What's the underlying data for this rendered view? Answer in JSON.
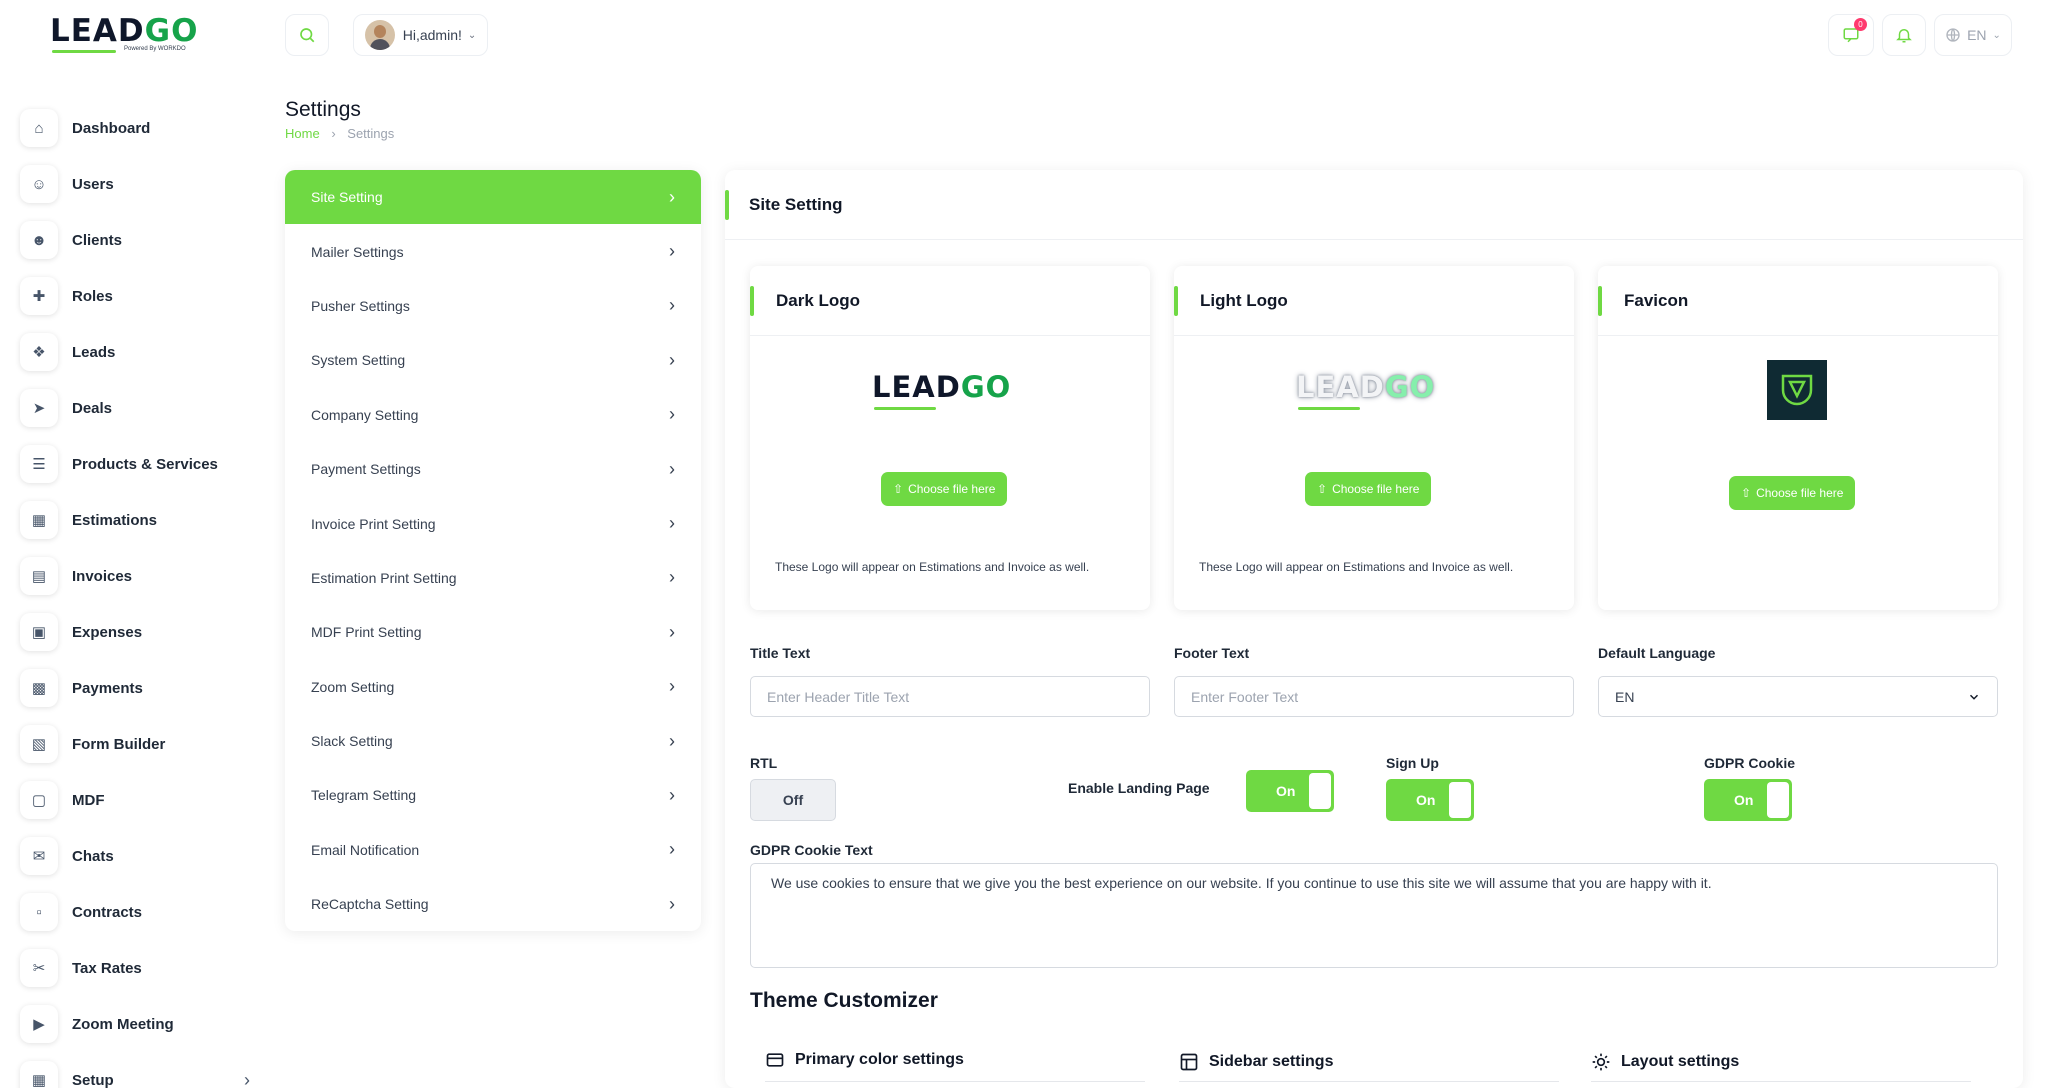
{
  "brand": {
    "logo_main": "LEAD",
    "logo_accent": "GO",
    "logo_sub": "Powered By WORKDO"
  },
  "topbar": {
    "user_greeting": "Hi,admin!",
    "notification_count": "0",
    "language": "EN"
  },
  "sidebar": {
    "items": [
      {
        "label": "Dashboard",
        "icon": "home-icon"
      },
      {
        "label": "Users",
        "icon": "users-icon"
      },
      {
        "label": "Clients",
        "icon": "user-icon"
      },
      {
        "label": "Roles",
        "icon": "user-plus-icon"
      },
      {
        "label": "Leads",
        "icon": "leads-icon"
      },
      {
        "label": "Deals",
        "icon": "rocket-icon"
      },
      {
        "label": "Products & Services",
        "icon": "products-icon"
      },
      {
        "label": "Estimations",
        "icon": "estimations-icon"
      },
      {
        "label": "Invoices",
        "icon": "file-icon"
      },
      {
        "label": "Expenses",
        "icon": "expenses-icon"
      },
      {
        "label": "Payments",
        "icon": "payments-icon"
      },
      {
        "label": "Form Builder",
        "icon": "form-icon"
      },
      {
        "label": "MDF",
        "icon": "mdf-icon"
      },
      {
        "label": "Chats",
        "icon": "chat-icon"
      },
      {
        "label": "Contracts",
        "icon": "contract-icon"
      },
      {
        "label": "Tax Rates",
        "icon": "scissors-icon"
      },
      {
        "label": "Zoom Meeting",
        "icon": "video-icon"
      },
      {
        "label": "Setup",
        "icon": "grid-icon"
      }
    ]
  },
  "page": {
    "title": "Settings",
    "breadcrumb_home": "Home",
    "breadcrumb_current": "Settings"
  },
  "settings_menu": [
    "Site Setting",
    "Mailer Settings",
    "Pusher Settings",
    "System Setting",
    "Company Setting",
    "Payment Settings",
    "Invoice Print Setting",
    "Estimation Print Setting",
    "MDF Print Setting",
    "Zoom Setting",
    "Slack Setting",
    "Telegram Setting",
    "Email Notification",
    "ReCaptcha Setting"
  ],
  "site_setting": {
    "title": "Site Setting",
    "dark_logo": {
      "title": "Dark Logo",
      "button": "Choose file here",
      "note": "These Logo will appear on Estimations and Invoice as well."
    },
    "light_logo": {
      "title": "Light Logo",
      "button": "Choose file here",
      "note": "These Logo will appear on Estimations and Invoice as well."
    },
    "favicon": {
      "title": "Favicon",
      "button": "Choose file here"
    },
    "title_text": {
      "label": "Title Text",
      "placeholder": "Enter Header Title Text"
    },
    "footer_text": {
      "label": "Footer Text",
      "placeholder": "Enter Footer Text"
    },
    "default_language": {
      "label": "Default Language",
      "value": "EN"
    },
    "rtl": {
      "label": "RTL",
      "state": "Off"
    },
    "landing_page": {
      "label": "Enable Landing Page",
      "state": "On"
    },
    "sign_up": {
      "label": "Sign Up",
      "state": "On"
    },
    "gdpr_cookie": {
      "label": "GDPR Cookie",
      "state": "On"
    },
    "gdpr_text": {
      "label": "GDPR Cookie Text",
      "value": "We use cookies to ensure that we give you the best experience on our website. If you continue to use this site we will assume that you are happy with it."
    },
    "theme": {
      "title": "Theme Customizer",
      "primary": "Primary color settings",
      "sidebar": "Sidebar settings",
      "layout": "Layout settings"
    }
  },
  "colors": {
    "accent": "#6fd943",
    "badge": "#ff3a6e"
  }
}
